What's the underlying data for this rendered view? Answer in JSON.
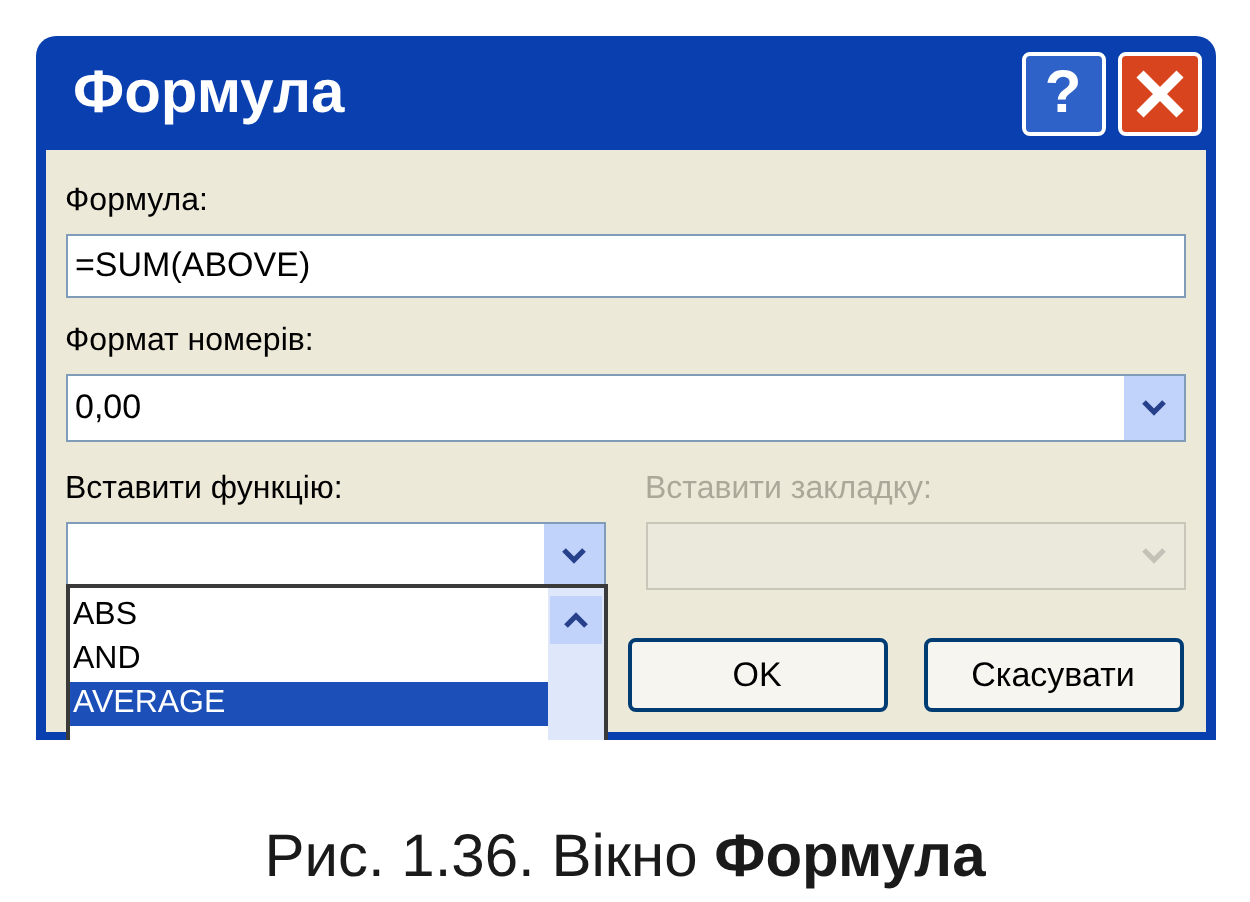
{
  "window": {
    "title": "Формула",
    "help": "?"
  },
  "formula": {
    "label": "Формула:",
    "value": "=SUM(ABOVE)"
  },
  "number_format": {
    "label": "Формат номерів:",
    "value": "0,00"
  },
  "insert_function": {
    "label": "Вставити функцію:",
    "expanded": true,
    "options": [
      {
        "label": "ABS",
        "selected": false
      },
      {
        "label": "AND",
        "selected": false
      },
      {
        "label": "AVERAGE",
        "selected": true
      }
    ]
  },
  "insert_bookmark": {
    "label": "Вставити закладку:",
    "disabled": true
  },
  "buttons": [
    "OK",
    "Скасувати"
  ],
  "caption": "Рис. 1.36. Вікно **Формула**"
}
